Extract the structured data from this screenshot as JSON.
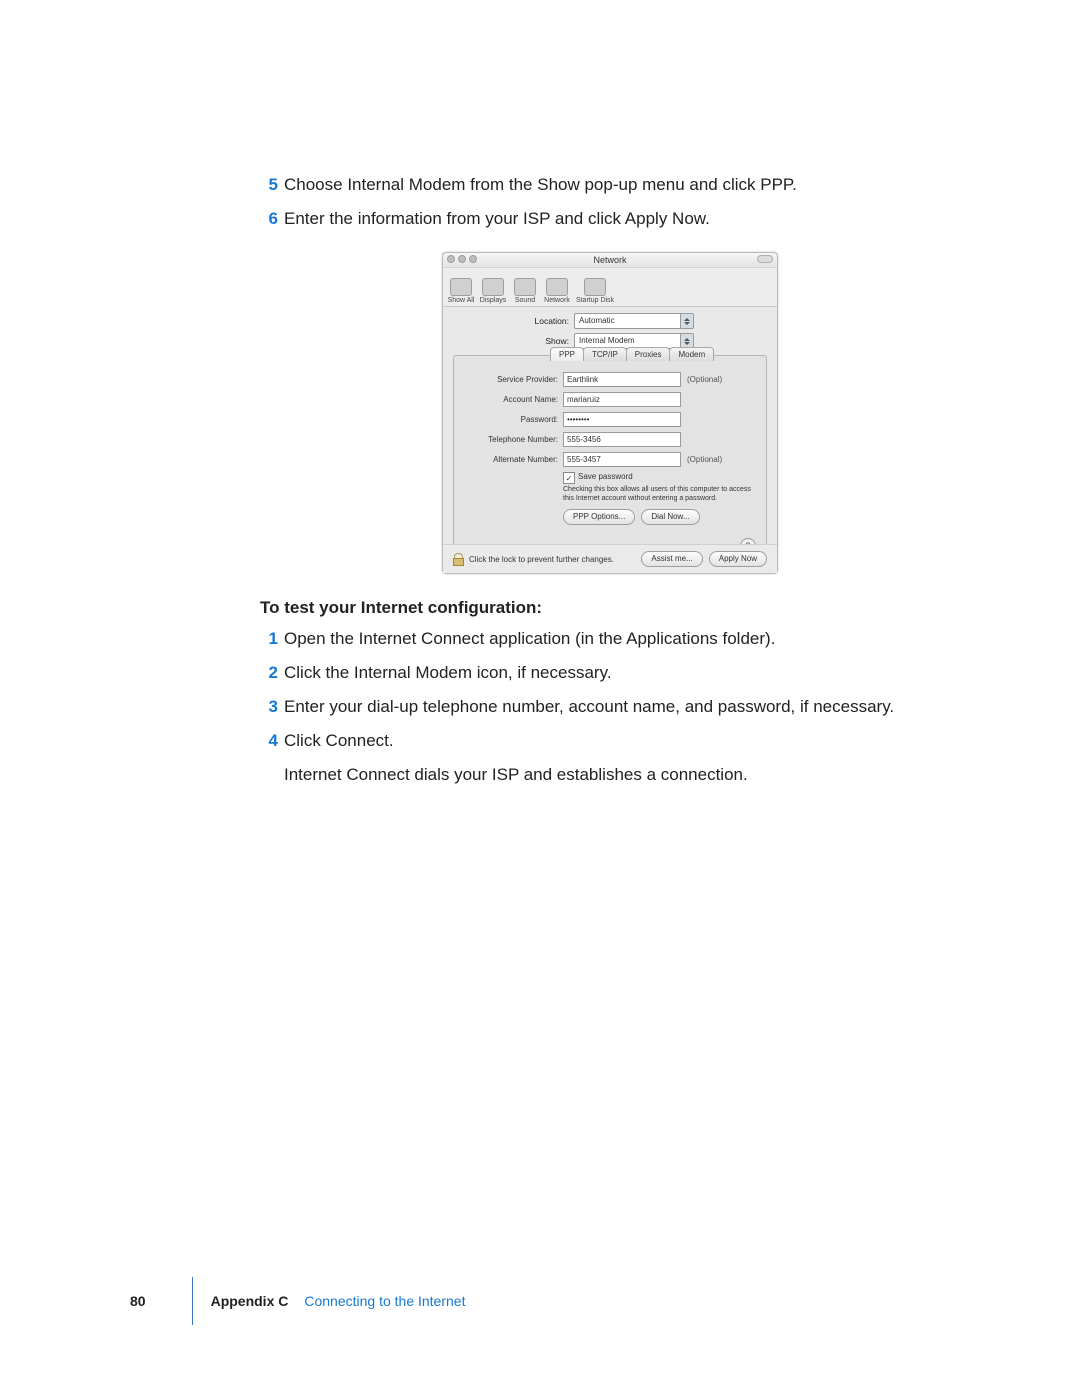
{
  "steps_above": [
    {
      "num": "5",
      "text": "Choose Internal Modem from the Show pop-up menu and click PPP."
    },
    {
      "num": "6",
      "text": "Enter the information from your ISP and click Apply Now."
    }
  ],
  "heading": "To test your Internet configuration:",
  "steps_below": [
    {
      "num": "1",
      "text": "Open the Internet Connect application (in the Applications folder)."
    },
    {
      "num": "2",
      "text": "Click the Internal Modem icon, if necessary."
    },
    {
      "num": "3",
      "text": "Enter your dial-up telephone number, account name, and password, if necessary."
    },
    {
      "num": "4",
      "text": "Click Connect."
    }
  ],
  "para_after": "Internet Connect dials your ISP and establishes a connection.",
  "footer_page": "80",
  "footer_appendix": "Appendix C",
  "footer_title": "Connecting to the Internet",
  "figure": {
    "window_title": "Network",
    "toolbar_items": [
      "Show All",
      "Displays",
      "Sound",
      "Network",
      "Startup Disk"
    ],
    "location_label": "Location:",
    "location_value": "Automatic",
    "show_label": "Show:",
    "show_value": "Internal Modem",
    "tabs": [
      "PPP",
      "TCP/IP",
      "Proxies",
      "Modem"
    ],
    "fields": {
      "service_provider_label": "Service Provider:",
      "service_provider_value": "Earthlink",
      "service_provider_optional": "(Optional)",
      "account_name_label": "Account Name:",
      "account_name_value": "mariaruiz",
      "password_label": "Password:",
      "password_value": "••••••••",
      "telephone_label": "Telephone Number:",
      "telephone_value": "555-3456",
      "alternate_label": "Alternate Number:",
      "alternate_value": "555-3457",
      "alternate_optional": "(Optional)"
    },
    "save_password_label": "Save password",
    "save_password_help": "Checking this box allows all users of this computer to access this Internet account without entering a password.",
    "ppp_options_btn": "PPP Options...",
    "dial_now_btn": "Dial Now...",
    "lock_text": "Click the lock to prevent further changes.",
    "assist_btn": "Assist me...",
    "apply_btn": "Apply Now",
    "help_q": "?"
  }
}
